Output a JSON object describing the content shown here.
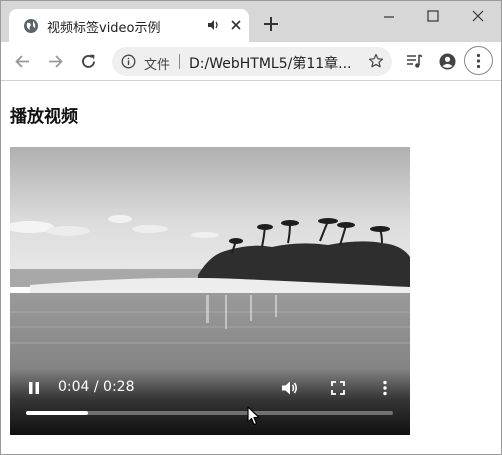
{
  "tab": {
    "title": "视频标签video示例",
    "favicon_icon": "globe-icon",
    "audio_icon": "speaker-icon",
    "close_icon": "close-icon"
  },
  "new_tab_icon": "plus-icon",
  "window_controls": [
    "minimize-icon",
    "maximize-icon",
    "close-icon"
  ],
  "toolbar": {
    "back_icon": "back-arrow-icon",
    "forward_icon": "forward-arrow-icon",
    "reload_icon": "reload-icon",
    "scheme_label": "文件",
    "url": "D:/WebHTML5/第11章...",
    "bookmark_icon": "star-icon",
    "extra_icons": [
      "media-queue-icon",
      "account-icon",
      "menu-dots-icon"
    ]
  },
  "page": {
    "heading": "播放视频"
  },
  "video": {
    "time": "0:04 / 0:28",
    "progress": 0.17,
    "state": "playing",
    "controls": [
      "pause-icon",
      "volume-icon",
      "fullscreen-icon",
      "more-icon"
    ]
  }
}
